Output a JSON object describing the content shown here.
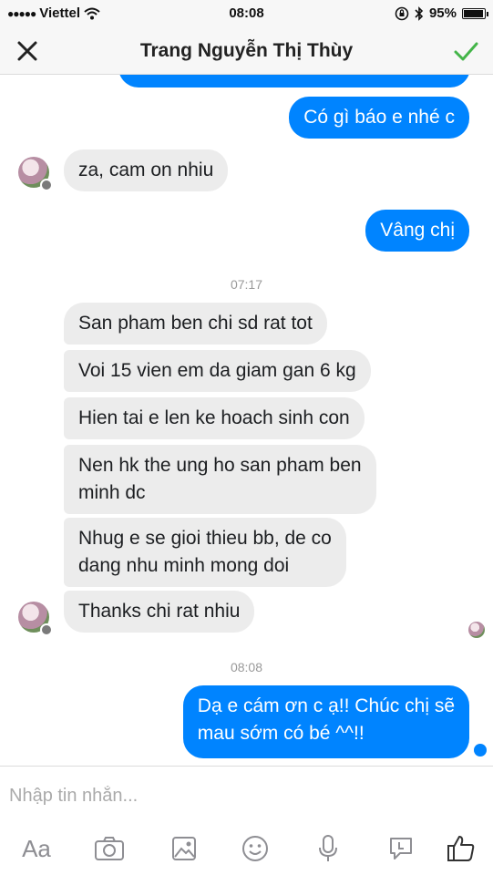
{
  "status_bar": {
    "carrier": "Viettel",
    "time": "08:08",
    "battery": "95%",
    "battery_level": 0.95
  },
  "header": {
    "title": "Trang Nguyễn Thị Thùy"
  },
  "messages": {
    "m1": "Có gì báo e nhé c",
    "m2": "za, cam on nhiu",
    "m3": "Vâng chị",
    "ts1": "07:17",
    "m4": "San pham ben chi sd rat tot",
    "m5": "Voi 15 vien em da giam gan 6 kg",
    "m6": "Hien tai e len ke hoach sinh con",
    "m7_line1": "Nen hk the ung ho san pham ben",
    "m7_line2": "minh dc",
    "m8_line1": "Nhug e se gioi thieu bb, de co",
    "m8_line2": "dang nhu minh mong doi",
    "m9": "Thanks chi rat nhiu",
    "ts2": "08:08",
    "m10_line1": "Dạ e cám ơn c ạ!! Chúc chị sẽ",
    "m10_line2": "mau sớm có bé ^^!!"
  },
  "composer": {
    "placeholder": "Nhập tin nhắn...",
    "aa_label": "Aa"
  },
  "colors": {
    "accent": "#0084ff",
    "incoming": "#ececec",
    "check": "#44b549"
  },
  "icons": [
    "close-icon",
    "checkmark-icon",
    "camera-icon",
    "gallery-icon",
    "emoji-icon",
    "microphone-icon",
    "sticker-icon",
    "like-icon"
  ]
}
